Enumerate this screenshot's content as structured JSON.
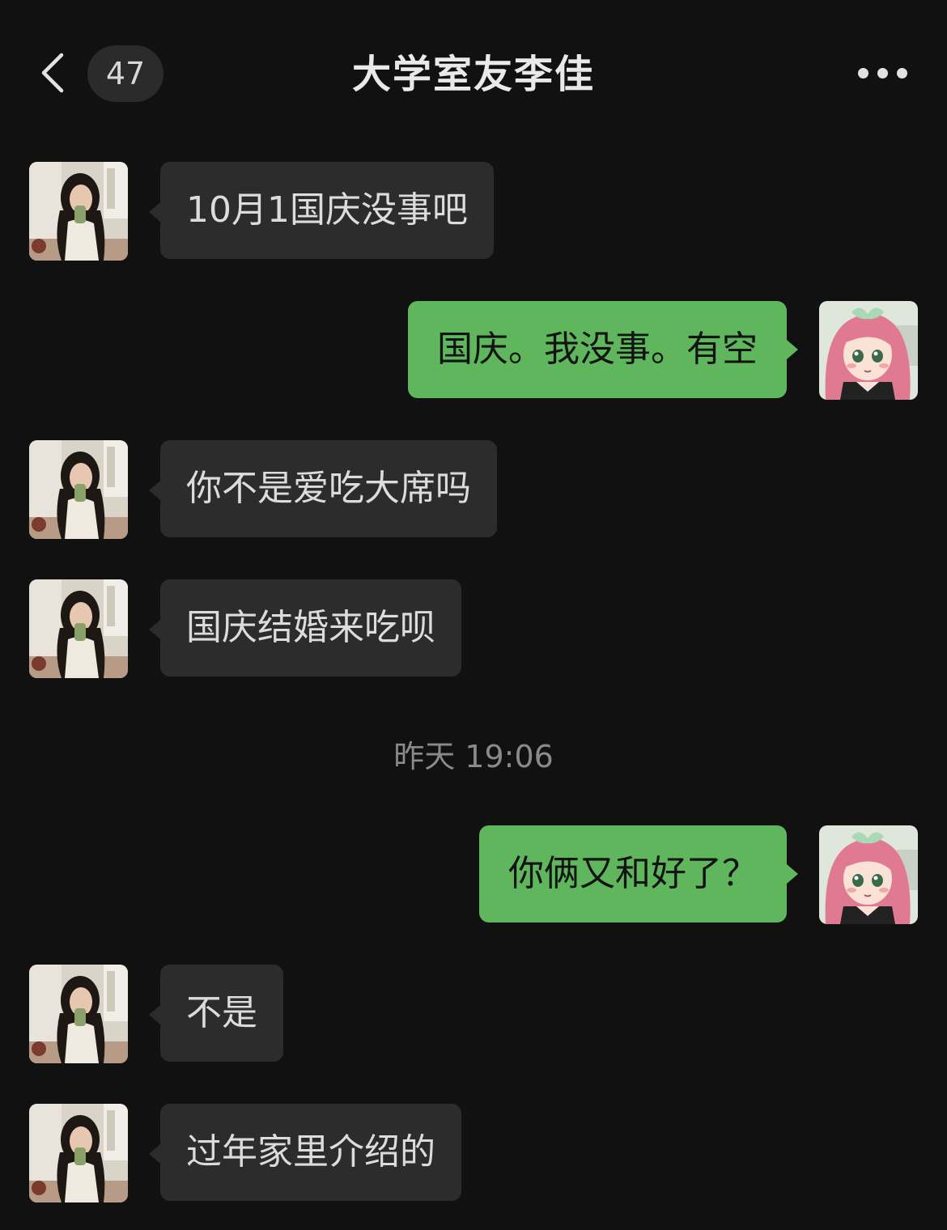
{
  "header": {
    "unread_count": "47",
    "title": "大学室友李佳",
    "back_icon": "chevron-left-icon",
    "more_icon": "ellipsis-icon"
  },
  "timestamp": "昨天 19:06",
  "messages": [
    {
      "direction": "incoming",
      "text": "10月1国庆没事吧"
    },
    {
      "direction": "outgoing",
      "text": "国庆。我没事。有空"
    },
    {
      "direction": "incoming",
      "text": "你不是爱吃大席吗"
    },
    {
      "direction": "incoming",
      "text": "国庆结婚来吃呗"
    },
    {
      "direction": "outgoing",
      "text": "你俩又和好了？"
    },
    {
      "direction": "incoming",
      "text": "不是"
    },
    {
      "direction": "incoming",
      "text": "过年家里介绍的"
    }
  ],
  "colors": {
    "background": "#111111",
    "incoming_bubble": "#2c2c2c",
    "outgoing_bubble": "#5fb65d"
  }
}
